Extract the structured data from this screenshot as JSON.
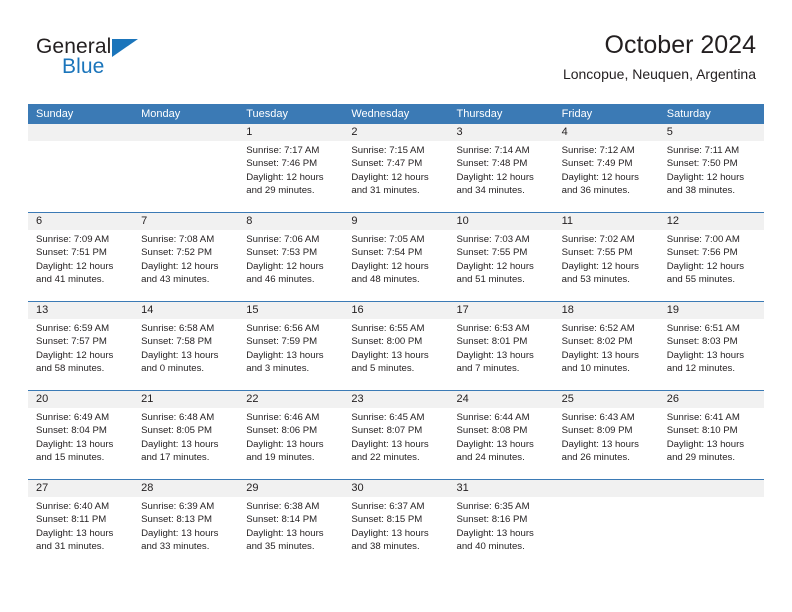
{
  "brand": {
    "name_part1": "General",
    "name_part2": "Blue",
    "colors": {
      "brand_blue": "#1b75bb",
      "header_blue": "#3b7ab5",
      "date_band_gray": "#f1f1f1",
      "text": "#231f20"
    }
  },
  "header": {
    "title": "October 2024",
    "subtitle": "Loncopue, Neuquen, Argentina"
  },
  "calendar": {
    "day_headers": [
      "Sunday",
      "Monday",
      "Tuesday",
      "Wednesday",
      "Thursday",
      "Friday",
      "Saturday"
    ],
    "weeks": [
      {
        "days": [
          {
            "num": "",
            "lines": []
          },
          {
            "num": "",
            "lines": []
          },
          {
            "num": "1",
            "lines": [
              "Sunrise: 7:17 AM",
              "Sunset: 7:46 PM",
              "Daylight: 12 hours",
              "and 29 minutes."
            ]
          },
          {
            "num": "2",
            "lines": [
              "Sunrise: 7:15 AM",
              "Sunset: 7:47 PM",
              "Daylight: 12 hours",
              "and 31 minutes."
            ]
          },
          {
            "num": "3",
            "lines": [
              "Sunrise: 7:14 AM",
              "Sunset: 7:48 PM",
              "Daylight: 12 hours",
              "and 34 minutes."
            ]
          },
          {
            "num": "4",
            "lines": [
              "Sunrise: 7:12 AM",
              "Sunset: 7:49 PM",
              "Daylight: 12 hours",
              "and 36 minutes."
            ]
          },
          {
            "num": "5",
            "lines": [
              "Sunrise: 7:11 AM",
              "Sunset: 7:50 PM",
              "Daylight: 12 hours",
              "and 38 minutes."
            ]
          }
        ]
      },
      {
        "days": [
          {
            "num": "6",
            "lines": [
              "Sunrise: 7:09 AM",
              "Sunset: 7:51 PM",
              "Daylight: 12 hours",
              "and 41 minutes."
            ]
          },
          {
            "num": "7",
            "lines": [
              "Sunrise: 7:08 AM",
              "Sunset: 7:52 PM",
              "Daylight: 12 hours",
              "and 43 minutes."
            ]
          },
          {
            "num": "8",
            "lines": [
              "Sunrise: 7:06 AM",
              "Sunset: 7:53 PM",
              "Daylight: 12 hours",
              "and 46 minutes."
            ]
          },
          {
            "num": "9",
            "lines": [
              "Sunrise: 7:05 AM",
              "Sunset: 7:54 PM",
              "Daylight: 12 hours",
              "and 48 minutes."
            ]
          },
          {
            "num": "10",
            "lines": [
              "Sunrise: 7:03 AM",
              "Sunset: 7:55 PM",
              "Daylight: 12 hours",
              "and 51 minutes."
            ]
          },
          {
            "num": "11",
            "lines": [
              "Sunrise: 7:02 AM",
              "Sunset: 7:55 PM",
              "Daylight: 12 hours",
              "and 53 minutes."
            ]
          },
          {
            "num": "12",
            "lines": [
              "Sunrise: 7:00 AM",
              "Sunset: 7:56 PM",
              "Daylight: 12 hours",
              "and 55 minutes."
            ]
          }
        ]
      },
      {
        "days": [
          {
            "num": "13",
            "lines": [
              "Sunrise: 6:59 AM",
              "Sunset: 7:57 PM",
              "Daylight: 12 hours",
              "and 58 minutes."
            ]
          },
          {
            "num": "14",
            "lines": [
              "Sunrise: 6:58 AM",
              "Sunset: 7:58 PM",
              "Daylight: 13 hours",
              "and 0 minutes."
            ]
          },
          {
            "num": "15",
            "lines": [
              "Sunrise: 6:56 AM",
              "Sunset: 7:59 PM",
              "Daylight: 13 hours",
              "and 3 minutes."
            ]
          },
          {
            "num": "16",
            "lines": [
              "Sunrise: 6:55 AM",
              "Sunset: 8:00 PM",
              "Daylight: 13 hours",
              "and 5 minutes."
            ]
          },
          {
            "num": "17",
            "lines": [
              "Sunrise: 6:53 AM",
              "Sunset: 8:01 PM",
              "Daylight: 13 hours",
              "and 7 minutes."
            ]
          },
          {
            "num": "18",
            "lines": [
              "Sunrise: 6:52 AM",
              "Sunset: 8:02 PM",
              "Daylight: 13 hours",
              "and 10 minutes."
            ]
          },
          {
            "num": "19",
            "lines": [
              "Sunrise: 6:51 AM",
              "Sunset: 8:03 PM",
              "Daylight: 13 hours",
              "and 12 minutes."
            ]
          }
        ]
      },
      {
        "days": [
          {
            "num": "20",
            "lines": [
              "Sunrise: 6:49 AM",
              "Sunset: 8:04 PM",
              "Daylight: 13 hours",
              "and 15 minutes."
            ]
          },
          {
            "num": "21",
            "lines": [
              "Sunrise: 6:48 AM",
              "Sunset: 8:05 PM",
              "Daylight: 13 hours",
              "and 17 minutes."
            ]
          },
          {
            "num": "22",
            "lines": [
              "Sunrise: 6:46 AM",
              "Sunset: 8:06 PM",
              "Daylight: 13 hours",
              "and 19 minutes."
            ]
          },
          {
            "num": "23",
            "lines": [
              "Sunrise: 6:45 AM",
              "Sunset: 8:07 PM",
              "Daylight: 13 hours",
              "and 22 minutes."
            ]
          },
          {
            "num": "24",
            "lines": [
              "Sunrise: 6:44 AM",
              "Sunset: 8:08 PM",
              "Daylight: 13 hours",
              "and 24 minutes."
            ]
          },
          {
            "num": "25",
            "lines": [
              "Sunrise: 6:43 AM",
              "Sunset: 8:09 PM",
              "Daylight: 13 hours",
              "and 26 minutes."
            ]
          },
          {
            "num": "26",
            "lines": [
              "Sunrise: 6:41 AM",
              "Sunset: 8:10 PM",
              "Daylight: 13 hours",
              "and 29 minutes."
            ]
          }
        ]
      },
      {
        "days": [
          {
            "num": "27",
            "lines": [
              "Sunrise: 6:40 AM",
              "Sunset: 8:11 PM",
              "Daylight: 13 hours",
              "and 31 minutes."
            ]
          },
          {
            "num": "28",
            "lines": [
              "Sunrise: 6:39 AM",
              "Sunset: 8:13 PM",
              "Daylight: 13 hours",
              "and 33 minutes."
            ]
          },
          {
            "num": "29",
            "lines": [
              "Sunrise: 6:38 AM",
              "Sunset: 8:14 PM",
              "Daylight: 13 hours",
              "and 35 minutes."
            ]
          },
          {
            "num": "30",
            "lines": [
              "Sunrise: 6:37 AM",
              "Sunset: 8:15 PM",
              "Daylight: 13 hours",
              "and 38 minutes."
            ]
          },
          {
            "num": "31",
            "lines": [
              "Sunrise: 6:35 AM",
              "Sunset: 8:16 PM",
              "Daylight: 13 hours",
              "and 40 minutes."
            ]
          },
          {
            "num": "",
            "lines": []
          },
          {
            "num": "",
            "lines": []
          }
        ]
      }
    ]
  }
}
